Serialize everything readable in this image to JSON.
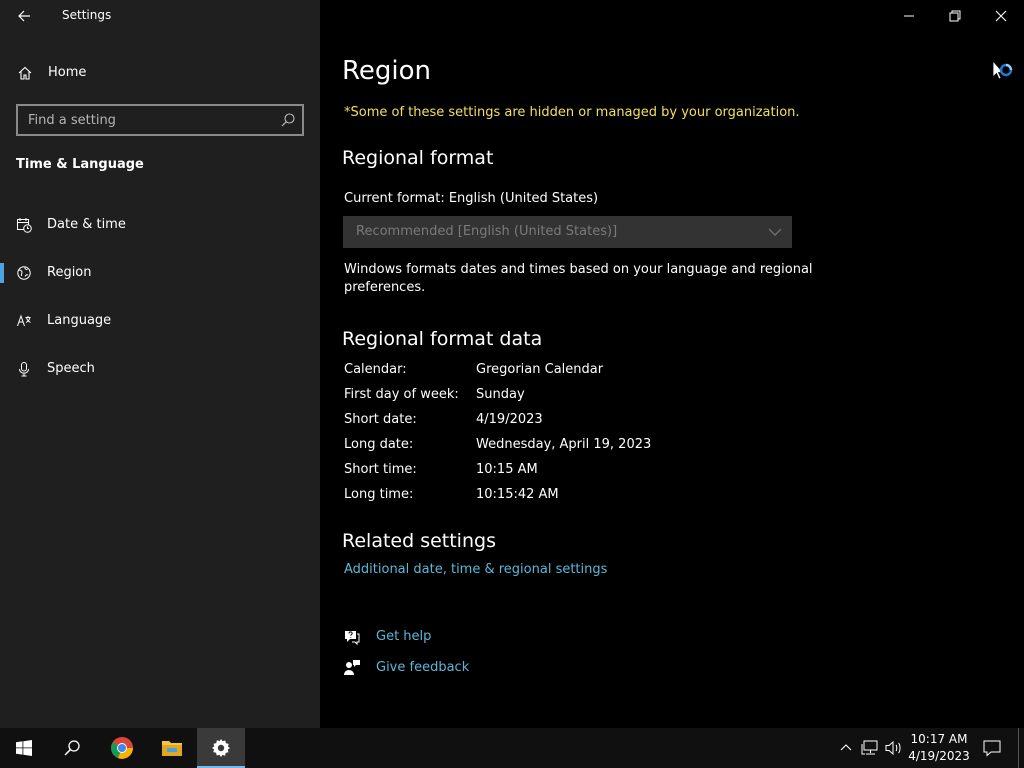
{
  "window": {
    "title": "Settings"
  },
  "sidebar": {
    "home_label": "Home",
    "search_placeholder": "Find a setting",
    "section_title": "Time & Language",
    "items": [
      {
        "label": "Date & time",
        "icon": "calendar-clock-icon"
      },
      {
        "label": "Region",
        "icon": "globe-icon",
        "selected": true
      },
      {
        "label": "Language",
        "icon": "language-icon"
      },
      {
        "label": "Speech",
        "icon": "microphone-icon"
      }
    ]
  },
  "main": {
    "title": "Region",
    "org_note": "*Some of these settings are hidden or managed by your organization.",
    "regional_format": {
      "heading": "Regional format",
      "current_format": "Current format: English (United States)",
      "dropdown_value": "Recommended [English (United States)]",
      "description": "Windows formats dates and times based on your language and regional preferences."
    },
    "regional_format_data": {
      "heading": "Regional format data",
      "rows": [
        {
          "key": "Calendar:",
          "value": "Gregorian Calendar"
        },
        {
          "key": "First day of week:",
          "value": "Sunday"
        },
        {
          "key": "Short date:",
          "value": "4/19/2023"
        },
        {
          "key": "Long date:",
          "value": "Wednesday, April 19, 2023"
        },
        {
          "key": "Short time:",
          "value": "10:15 AM"
        },
        {
          "key": "Long time:",
          "value": "10:15:42 AM"
        }
      ]
    },
    "related": {
      "heading": "Related settings",
      "link": "Additional date, time & regional settings"
    },
    "help": {
      "get_help": "Get help",
      "give_feedback": "Give feedback"
    }
  },
  "taskbar": {
    "time": "10:17 AM",
    "date": "4/19/2023"
  },
  "colors": {
    "accent": "#4fa3e0",
    "warning": "#f1e05a",
    "link": "#5bb8d8"
  }
}
